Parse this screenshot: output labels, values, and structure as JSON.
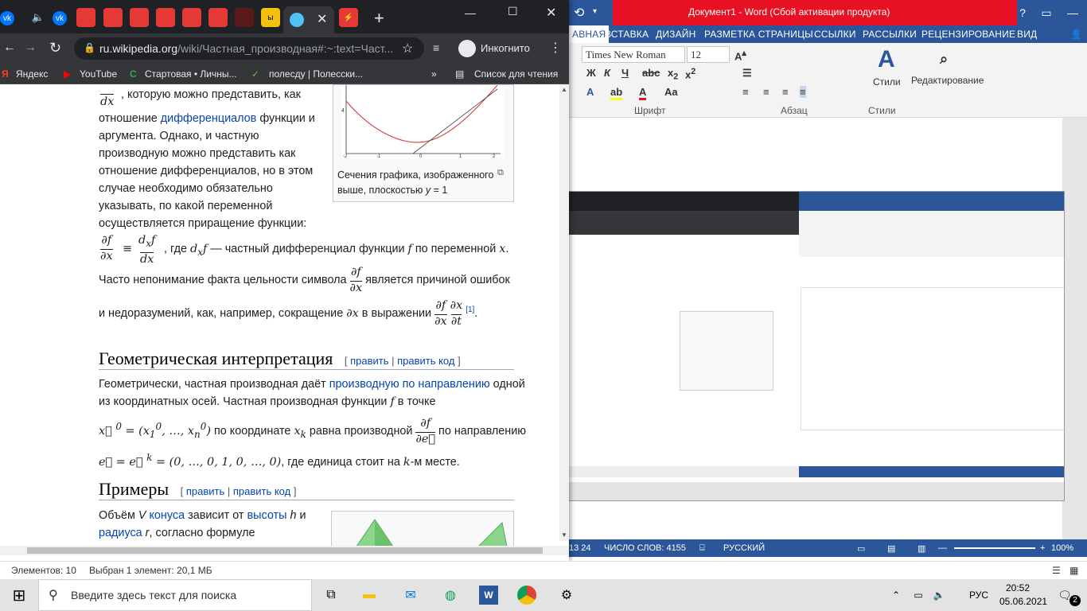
{
  "chrome": {
    "new_tab": "+",
    "url_host": "ru.wikipedia.org",
    "url_path": "/wiki/Частная_производная#:~:text=Част...",
    "incognito_label": "Инкогнито",
    "bookmarks": [
      "Яндекс",
      "YouTube",
      "Стартовая • Личны...",
      "полесду | Полесски..."
    ],
    "reading_list": "Список для чтения"
  },
  "article": {
    "frac_top": "dx",
    "p1_tail": ", которую можно представить, как",
    "p1_line2_pre": "отношение ",
    "p1_line2_link": "дифференциалов",
    "p1_line2_post": " функции и",
    "p1_lines": [
      "аргумента. Однако, и частную",
      "производную можно представить как",
      "отношение дифференциалов, но в этом",
      "случае необходимо обязательно",
      "указывать, по какой переменной",
      "осуществляется приращение функции:"
    ],
    "eq1_tail": ", где",
    "eq1_text": " — частный дифференциал функции",
    "eq1_text2": " по переменной",
    "p2_pre": "Часто непонимание факта цельности символа",
    "p2_post": "является причиной ошибок",
    "p3_pre": "и недоразумений, как, например, сокращение",
    "p3_mid": "в выражении",
    "p3_ref": "[1]",
    "thumb1_caption_1": "Сечения графика, изображенного",
    "thumb1_caption_2": "выше, плоскостью",
    "thumb1_caption_3": "y",
    "thumb1_caption_4": " = 1",
    "section1_title": "Геометрическая интерпретация",
    "edit": "править",
    "edit_code": "править код",
    "g1_pre": "Геометрически, частная производная даёт ",
    "g1_link": "производную по направлению",
    "g1_post": " одной",
    "g2": "из координатных осей. Частная производная функции",
    "g2_end": "в точке",
    "g3_mid": "по координате",
    "g3_mid2": "равна производной",
    "g3_end": "по направлению",
    "g4_end": ", где единица стоит на",
    "g4_end2": "-м месте.",
    "section2_title": "Примеры",
    "ex_pre": "Объём ",
    "ex_v": "V",
    "ex_link1": "конуса",
    "ex_mid": " зависит от ",
    "ex_link2": "высоты",
    "ex_h": " h",
    "ex_and": " и",
    "ex_link3": "радиуса",
    "ex_r": " r",
    "ex_post": ", согласно формуле"
  },
  "word": {
    "title": "Документ1 - Word (Сбой активации продукта)",
    "tabs": [
      "АВНАЯ",
      "ВСТАВКА",
      "ДИЗАЙН",
      "РАЗМЕТКА СТРАНИЦЫ",
      "ССЫЛКИ",
      "РАССЫЛКИ",
      "РЕЦЕНЗИРОВАНИЕ",
      "ВИД"
    ],
    "font_name": "Times New Roman",
    "font_size": "12",
    "group_font": "Шрифт",
    "group_paragraph": "Абзац",
    "styles": "Стили",
    "editing": "Редактирование",
    "status_page": "13 24",
    "status_words": "ЧИСЛО СЛОВ: 4155",
    "status_lang": "РУССКИЙ",
    "zoom": "100%"
  },
  "explorer": {
    "items": "Элементов: 10",
    "selected": "Выбран 1 элемент: 20,1 МБ"
  },
  "taskbar": {
    "search_placeholder": "Введите здесь текст для поиска",
    "lang": "РУС",
    "time": "20:52",
    "date": "05.06.2021",
    "notifications": "2"
  }
}
